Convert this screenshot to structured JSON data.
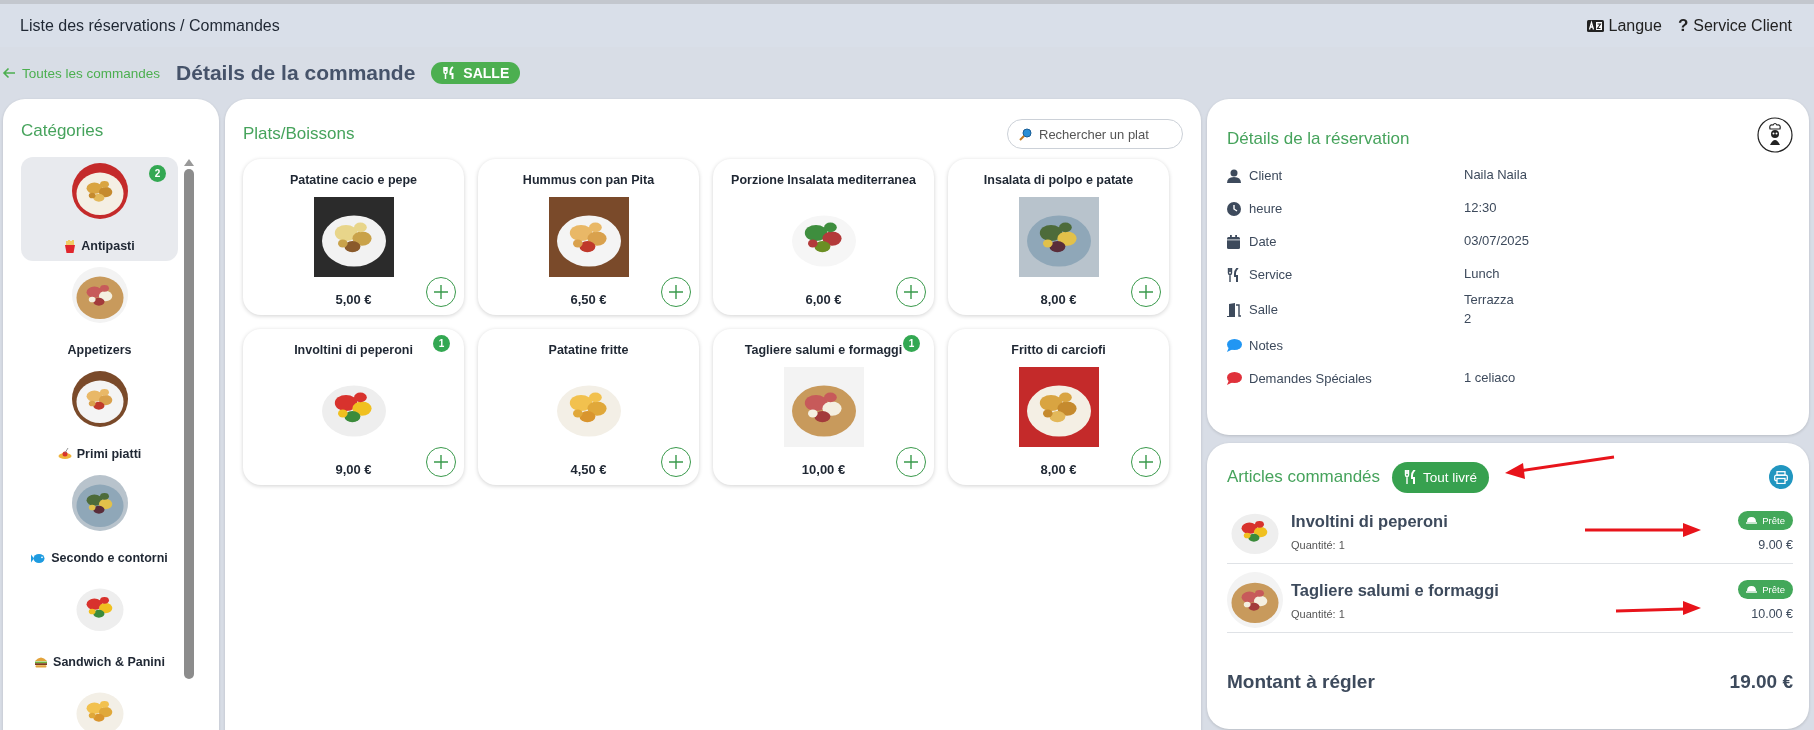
{
  "breadcrumb": "Liste des réservations / Commandes",
  "language": {
    "label": "Langue"
  },
  "help": {
    "icon": "?",
    "label": "Service Client"
  },
  "header": {
    "back_link": "Toutes les commandes",
    "title": "Détails de la commande",
    "badge": "SALLE"
  },
  "categories": {
    "title": "Catégories",
    "items": [
      {
        "name": "Antipasti",
        "selected": true,
        "count": "2"
      },
      {
        "name": "Appetizers",
        "selected": false
      },
      {
        "name": "Primi piatti",
        "selected": false
      },
      {
        "name": "Secondo e contorni",
        "selected": false
      },
      {
        "name": "Sandwich & Panini",
        "selected": false
      },
      {
        "selected": false
      }
    ]
  },
  "dishes": {
    "title": "Plats/Boissons",
    "search": {
      "placeholder": "Rechercher un plat"
    },
    "items": [
      {
        "name": "Patatine cacio e pepe",
        "price": "5,00 €"
      },
      {
        "name": "Hummus con pan Pita",
        "price": "6,50 €"
      },
      {
        "name": "Porzione Insalata mediterranea",
        "price": "6,00 €"
      },
      {
        "name": "Insalata di polpo e patate",
        "price": "8,00 €"
      },
      {
        "name": "Involtini di peperoni",
        "price": "9,00 €",
        "count": "1"
      },
      {
        "name": "Patatine fritte",
        "price": "4,50 €"
      },
      {
        "name": "Tagliere salumi e formaggi",
        "price": "10,00 €",
        "count": "1"
      },
      {
        "name": "Fritto di carciofi",
        "price": "8,00 €"
      }
    ]
  },
  "reservation": {
    "title": "Détails de la réservation",
    "rows": [
      {
        "kind": "user",
        "label": "Client",
        "value": "Naila Naila",
        "color": "#3d4a5c"
      },
      {
        "kind": "clock",
        "label": "heure",
        "value": "12:30",
        "color": "#3d4a5c"
      },
      {
        "kind": "calendar",
        "label": "Date",
        "value": "03/07/2025",
        "color": "#3d4a5c"
      },
      {
        "kind": "cutlery",
        "label": "Service",
        "value": "Lunch",
        "color": "#3d4a5c"
      },
      {
        "kind": "door",
        "label": "Salle",
        "value": "Terrazza\n2",
        "color": "#3d4a5c"
      },
      {
        "kind": "comment",
        "label": "Notes",
        "color": "#2196f3"
      },
      {
        "kind": "comment",
        "label": "Demandes Spéciales",
        "value": "1 celiaco",
        "color": "#e0313b"
      }
    ]
  },
  "articles": {
    "title": "Articles commandés",
    "deliver_button": "Tout livré",
    "items": [
      {
        "name": "Involtini di peperoni",
        "quantity": "Quantité: 1",
        "status": "Prête",
        "price": "9.00 €"
      },
      {
        "name": "Tagliere salumi e formaggi",
        "quantity": "Quantité: 1",
        "status": "Prête",
        "price": "10.00 €"
      }
    ],
    "total": {
      "label": "Montant à régler",
      "value": "19.00 €"
    }
  }
}
